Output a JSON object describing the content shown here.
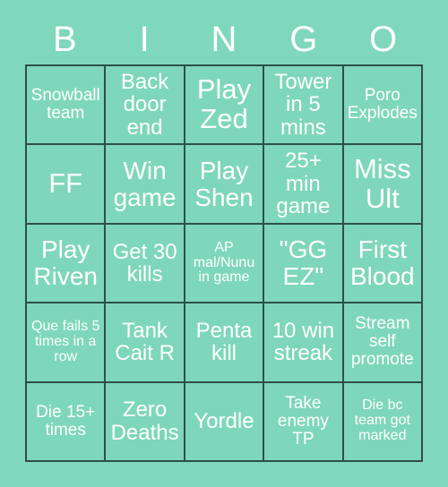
{
  "card": {
    "title": "BINGO",
    "header_letters": [
      "B",
      "I",
      "N",
      "G",
      "O"
    ],
    "colors": {
      "background": "#7fd8bb",
      "cell_fill": "#7ed7ba",
      "border": "#2e4f46",
      "text": "#ffffff"
    },
    "grid_size": "5x5",
    "rows": [
      [
        {
          "text": "Snowball team",
          "size": "sm"
        },
        {
          "text": "Back door end",
          "size": "md"
        },
        {
          "text": "Play Zed",
          "size": "xl"
        },
        {
          "text": "Tower in 5 mins",
          "size": "md"
        },
        {
          "text": "Poro Explodes",
          "size": "sm"
        }
      ],
      [
        {
          "text": "FF",
          "size": "xl"
        },
        {
          "text": "Win game",
          "size": "lg"
        },
        {
          "text": "Play Shen",
          "size": "lg"
        },
        {
          "text": "25+ min game",
          "size": "md"
        },
        {
          "text": "Miss Ult",
          "size": "xl"
        }
      ],
      [
        {
          "text": "Play Riven",
          "size": "lg"
        },
        {
          "text": "Get 30 kills",
          "size": "md"
        },
        {
          "text": "AP mal/Nunu in game",
          "size": "xs"
        },
        {
          "text": "\"GG EZ\"",
          "size": "lg"
        },
        {
          "text": "First Blood",
          "size": "lg"
        }
      ],
      [
        {
          "text": "Que fails 5 times in a row",
          "size": "xs"
        },
        {
          "text": "Tank Cait R",
          "size": "md"
        },
        {
          "text": "Penta kill",
          "size": "md"
        },
        {
          "text": "10 win streak",
          "size": "md"
        },
        {
          "text": "Stream self promote",
          "size": "sm"
        }
      ],
      [
        {
          "text": "Die 15+ times",
          "size": "sm"
        },
        {
          "text": "Zero Deaths",
          "size": "md"
        },
        {
          "text": "Yordle",
          "size": "md"
        },
        {
          "text": "Take enemy TP",
          "size": "sm"
        },
        {
          "text": "Die bc team got marked",
          "size": "xs"
        }
      ]
    ]
  }
}
